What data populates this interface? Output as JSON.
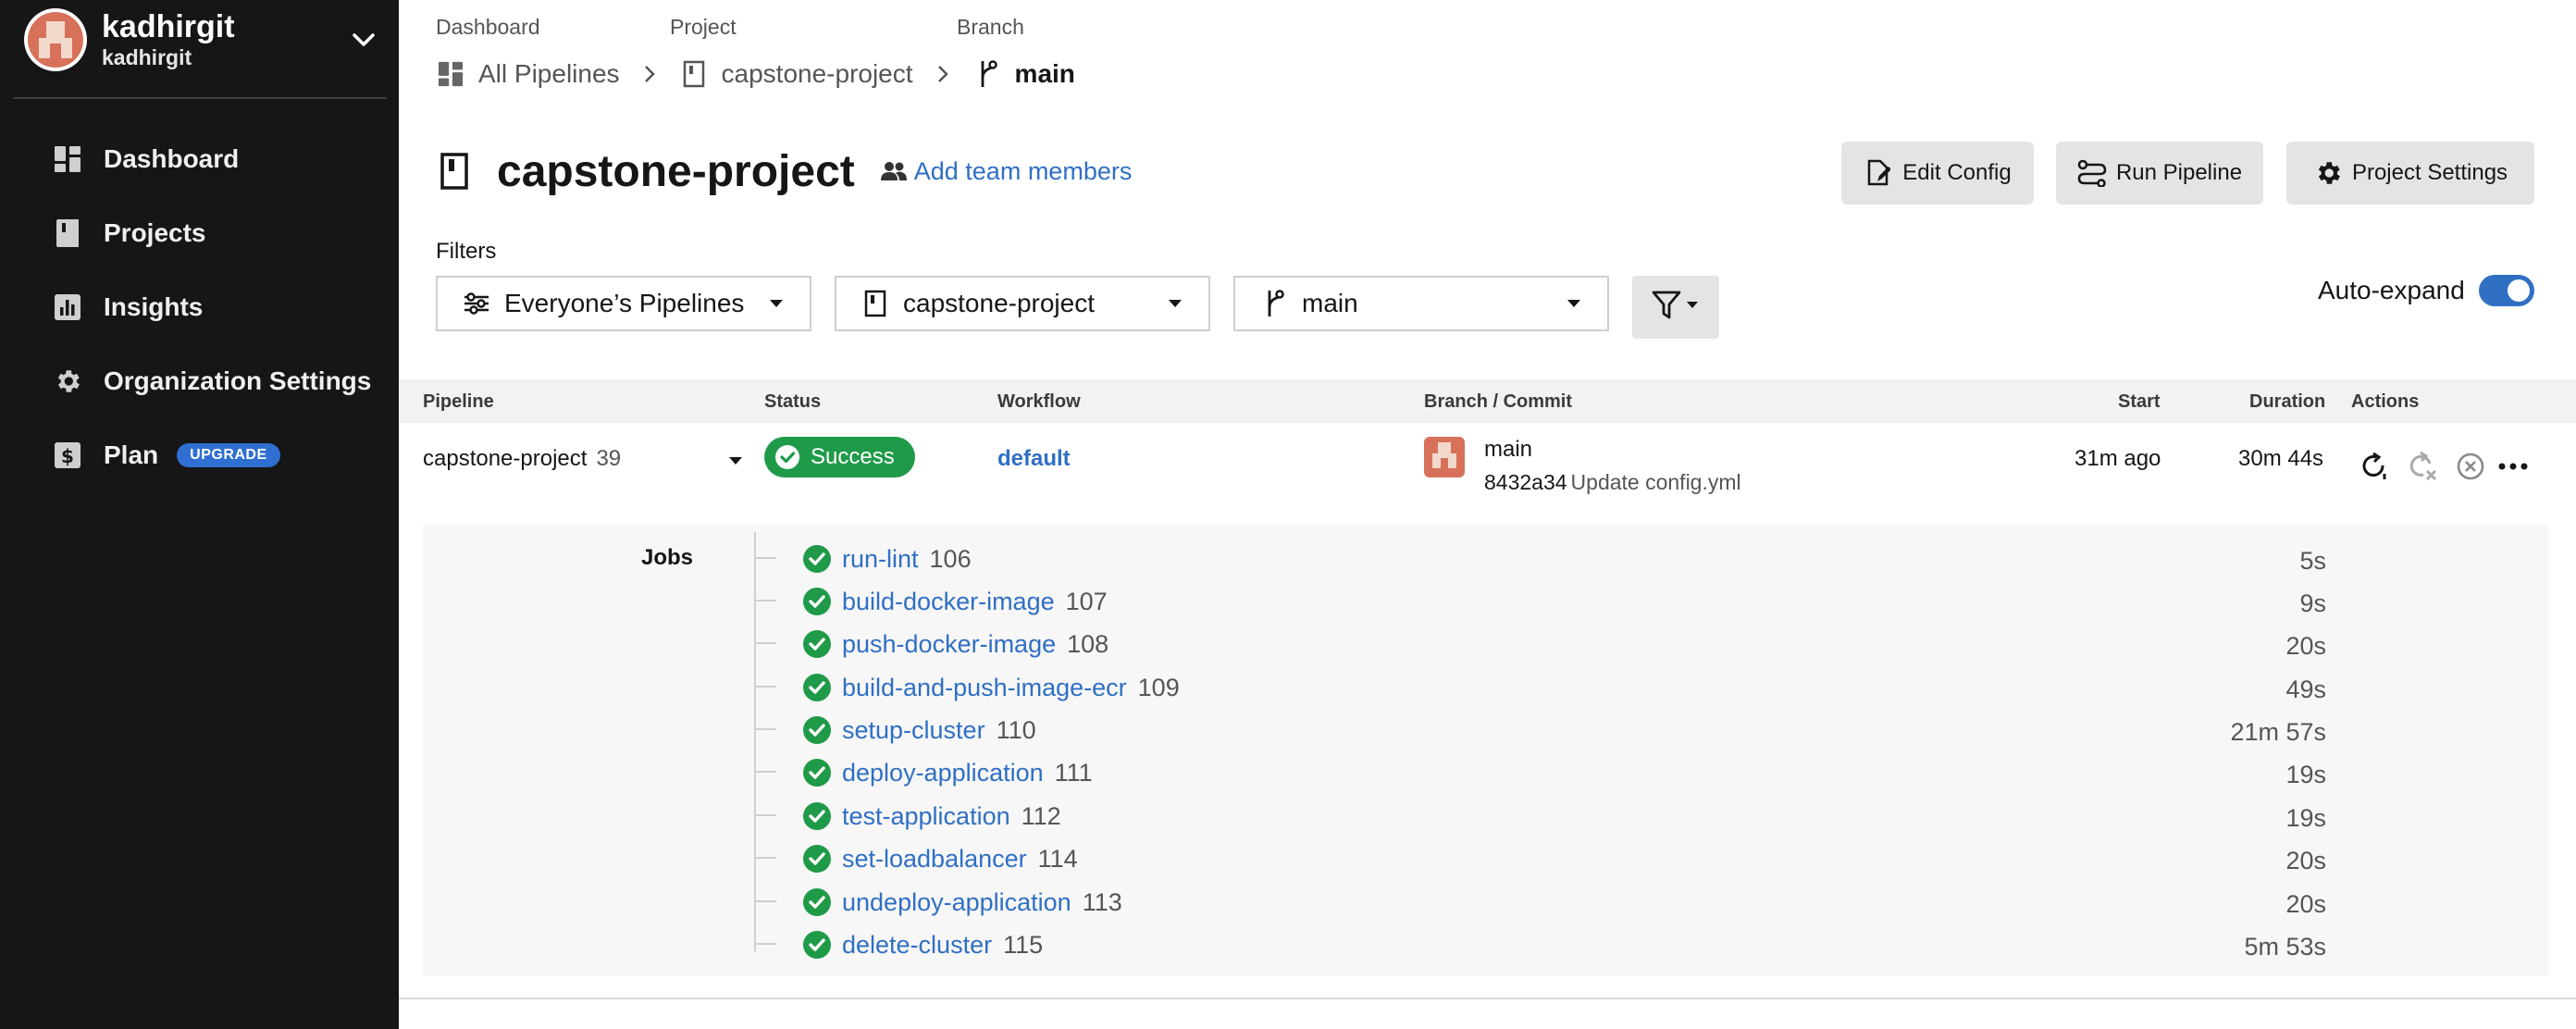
{
  "sidebar": {
    "org_name": "kadhirgit",
    "org_sub": "kadhirgit",
    "items": [
      {
        "label": "Dashboard",
        "icon": "dashboard-icon"
      },
      {
        "label": "Projects",
        "icon": "projects-icon"
      },
      {
        "label": "Insights",
        "icon": "insights-icon"
      },
      {
        "label": "Organization Settings",
        "icon": "gear-icon"
      },
      {
        "label": "Plan",
        "icon": "dollar-icon",
        "badge": "UPGRADE"
      }
    ]
  },
  "breadcrumb": {
    "labels": [
      "Dashboard",
      "Project",
      "Branch"
    ],
    "items": [
      "All Pipelines",
      "capstone-project",
      "main"
    ]
  },
  "header": {
    "title": "capstone-project",
    "add_team": "Add team members",
    "buttons": {
      "edit_config": "Edit Config",
      "run_pipeline": "Run Pipeline",
      "project_settings": "Project Settings"
    }
  },
  "filters": {
    "label": "Filters",
    "pipelines": "Everyone’s Pipelines",
    "project": "capstone-project",
    "branch": "main",
    "auto_expand": "Auto-expand",
    "auto_expand_on": true
  },
  "table": {
    "headers": [
      "Pipeline",
      "Status",
      "Workflow",
      "Branch / Commit",
      "Start",
      "Duration",
      "Actions"
    ],
    "row": {
      "pipeline": "capstone-project",
      "number": "39",
      "status": "Success",
      "workflow": "default",
      "branch": "main",
      "commit_hash": "8432a34",
      "commit_msg": "Update config.yml",
      "start": "31m ago",
      "duration": "30m 44s"
    }
  },
  "jobs": {
    "label": "Jobs",
    "items": [
      {
        "name": "run-lint",
        "num": "106",
        "dur": "5s"
      },
      {
        "name": "build-docker-image",
        "num": "107",
        "dur": "9s"
      },
      {
        "name": "push-docker-image",
        "num": "108",
        "dur": "20s"
      },
      {
        "name": "build-and-push-image-ecr",
        "num": "109",
        "dur": "49s"
      },
      {
        "name": "setup-cluster",
        "num": "110",
        "dur": "21m 57s"
      },
      {
        "name": "deploy-application",
        "num": "111",
        "dur": "19s"
      },
      {
        "name": "test-application",
        "num": "112",
        "dur": "19s"
      },
      {
        "name": "set-loadbalancer",
        "num": "114",
        "dur": "20s"
      },
      {
        "name": "undeploy-application",
        "num": "113",
        "dur": "20s"
      },
      {
        "name": "delete-cluster",
        "num": "115",
        "dur": "5m 53s"
      }
    ]
  },
  "colors": {
    "sidebar_bg": "#161616",
    "accent": "#2f6fc4",
    "success": "#1f9a48",
    "upgrade_badge": "#2f6fd1"
  }
}
